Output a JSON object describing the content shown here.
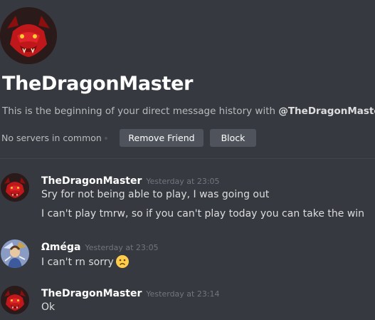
{
  "profile": {
    "title": "TheDragonMaster",
    "subtitle_prefix": "This is the beginning of your direct message history with ",
    "subtitle_mention": "@TheDragonMaster",
    "subtitle_suffix": ".",
    "servers_text": "No servers in common",
    "remove_friend_label": "Remove Friend",
    "block_label": "Block",
    "avatar_icon": "red-dragon-avatar"
  },
  "messages": [
    {
      "username": "TheDragonMaster",
      "timestamp": "Yesterday at 23:05",
      "avatar_icon": "red-dragon-avatar",
      "lines": [
        "Sry for not being able to play, I was going out",
        "I can't play tmrw, so if you can't play today you can take the win"
      ]
    },
    {
      "username": "Ωméga",
      "timestamp": "Yesterday at 23:05",
      "avatar_icon": "blue-warrior-avatar",
      "lines": [
        "I can't rn sorry"
      ],
      "emoji": "frowning-face-emoji"
    },
    {
      "username": "TheDragonMaster",
      "timestamp": "Yesterday at 23:14",
      "avatar_icon": "red-dragon-avatar",
      "lines": [
        "Ok"
      ]
    }
  ],
  "colors": {
    "background": "#36393f",
    "button": "#4f545c",
    "username": "#ffffff",
    "timestamp": "#72767d",
    "text": "#dcddde"
  }
}
